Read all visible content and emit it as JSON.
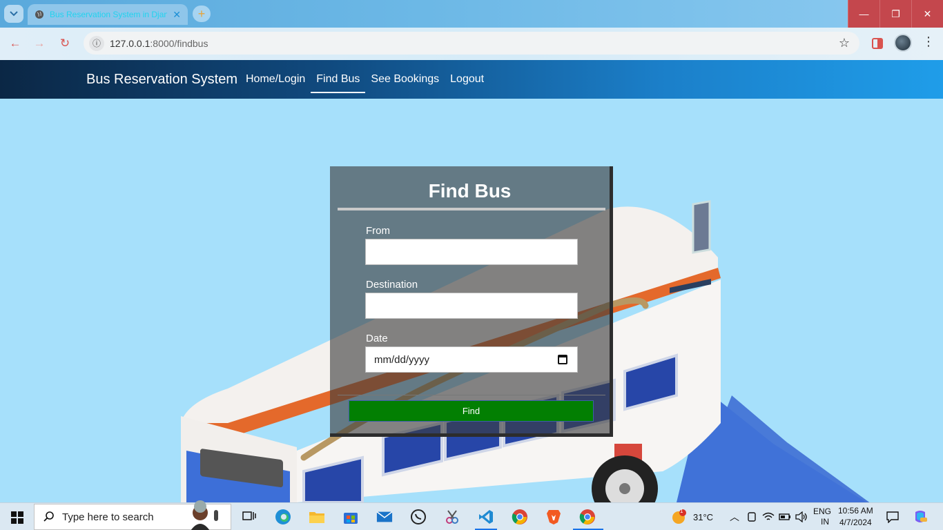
{
  "browser": {
    "tab_title": "Bus Reservation System in Djan",
    "url_host": "127.0.0.1",
    "url_path": ":8000/findbus",
    "minimize": "—",
    "restore": "❐",
    "close": "✕"
  },
  "navbar": {
    "brand": "Bus Reservation System",
    "links": [
      {
        "label": "Home/Login",
        "active": false
      },
      {
        "label": "Find Bus",
        "active": true
      },
      {
        "label": "See Bookings",
        "active": false
      },
      {
        "label": "Logout",
        "active": false
      }
    ]
  },
  "form": {
    "title": "Find Bus",
    "from_label": "From",
    "from_value": "",
    "destination_label": "Destination",
    "destination_value": "",
    "date_label": "Date",
    "date_placeholder": "mm/dd/yyyy",
    "submit_label": "Find",
    "submit_color": "#027f02"
  },
  "taskbar": {
    "search_placeholder": "Type here to search",
    "weather_temp": "31°C",
    "weather_badge": "1",
    "language": "ENG",
    "region": "IN",
    "time": "10:56 AM",
    "date": "4/7/2024",
    "pinned_icons": [
      "task-view-icon",
      "edge-icon",
      "file-explorer-icon",
      "store-icon",
      "mail-icon",
      "whatsapp-icon",
      "snipping-tool-icon",
      "vscode-icon",
      "chrome-icon",
      "brave-icon",
      "chrome-active-icon"
    ]
  },
  "colors": {
    "page_background": "#a6e0fb",
    "navbar_start": "#0b2745",
    "navbar_end": "#1f9de9",
    "window_controls": "#c4474d"
  }
}
